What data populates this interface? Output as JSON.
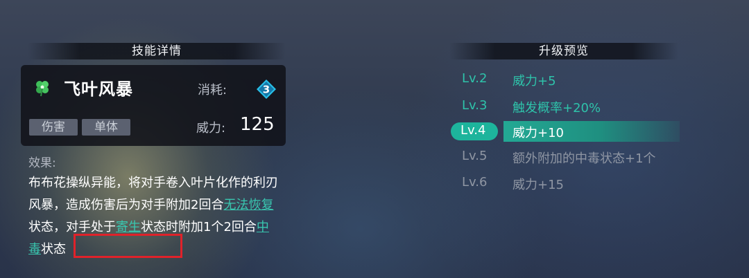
{
  "skill_panel": {
    "title": "技能详情",
    "name": "飞叶风暴",
    "icon": "clover-icon",
    "cost_label": "消耗:",
    "cost_value": "3",
    "tags": [
      "伤害",
      "单体"
    ],
    "power_label": "威力:",
    "power_value": "125",
    "effect_label": "效果:",
    "effect": {
      "part1": "布布花操纵异能，将对手卷入叶片化作的利刃风暴，造成伤害后为对手附加2回合",
      "link1": "无法恢复",
      "part2": "状态，对手处于",
      "link2": "寄生",
      "part3": "状态时附加1个2回合",
      "link3": "中毒",
      "part4": "状态"
    }
  },
  "upgrade_panel": {
    "title": "升级预览",
    "levels": [
      {
        "level": "Lv.2",
        "desc": "威力+5",
        "state": "unlocked"
      },
      {
        "level": "Lv.3",
        "desc": "触发概率+20%",
        "state": "unlocked"
      },
      {
        "level": "Lv.4",
        "desc": "威力+10",
        "state": "current"
      },
      {
        "level": "Lv.5",
        "desc": "额外附加的中毒状态+1个",
        "state": "locked"
      },
      {
        "level": "Lv.6",
        "desc": "威力+15",
        "state": "locked"
      }
    ]
  },
  "colors": {
    "accent_teal": "#2ec3aa",
    "highlight_red": "#e0222a",
    "locked_grey": "#8f96a3"
  }
}
